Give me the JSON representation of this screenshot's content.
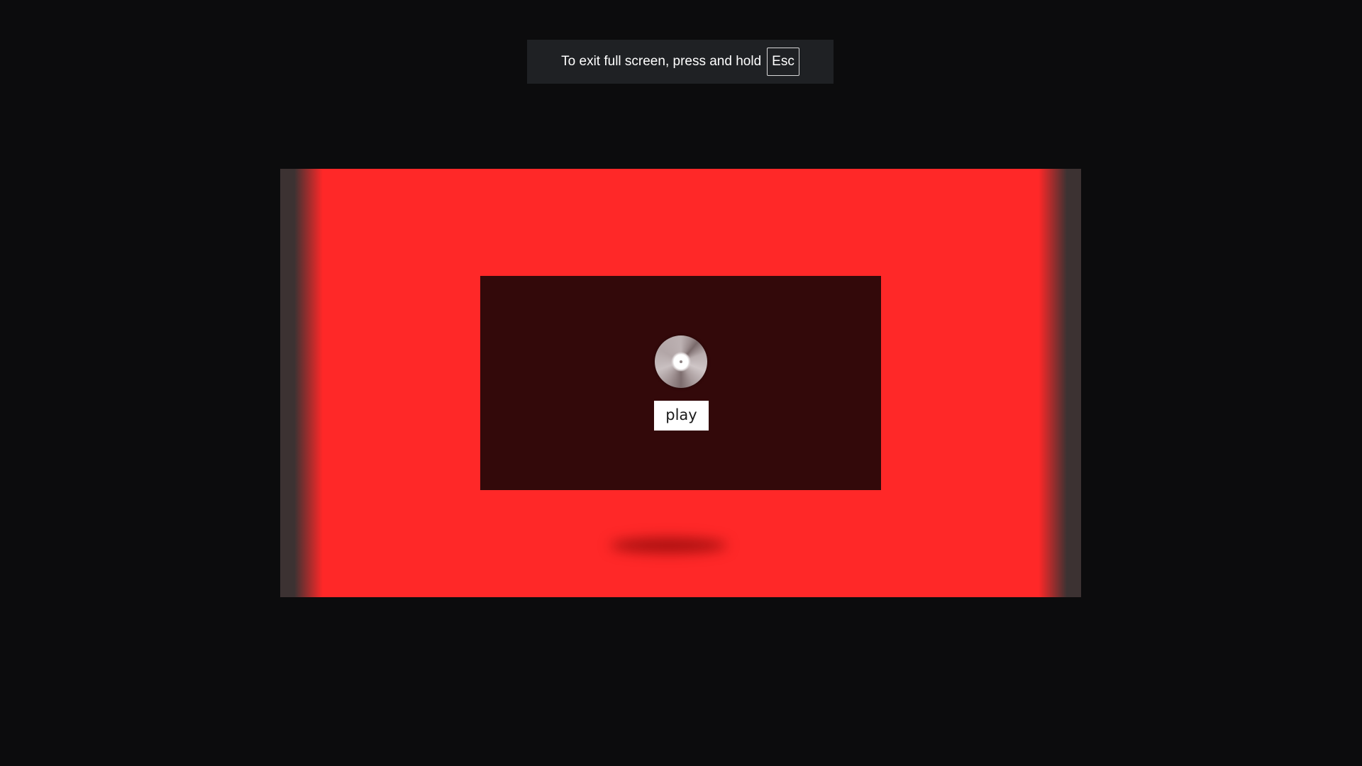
{
  "fullscreen_notice": {
    "text": "To exit full screen, press and hold",
    "key": "Esc"
  },
  "player": {
    "disc_icon": "disc-icon",
    "play_label": "play"
  },
  "colors": {
    "page_background": "#0c0c0d",
    "notice_background": "#1f2124",
    "stage_red": "#ff2828",
    "panel_dark_red": "#33090a",
    "button_white": "#ffffff"
  }
}
